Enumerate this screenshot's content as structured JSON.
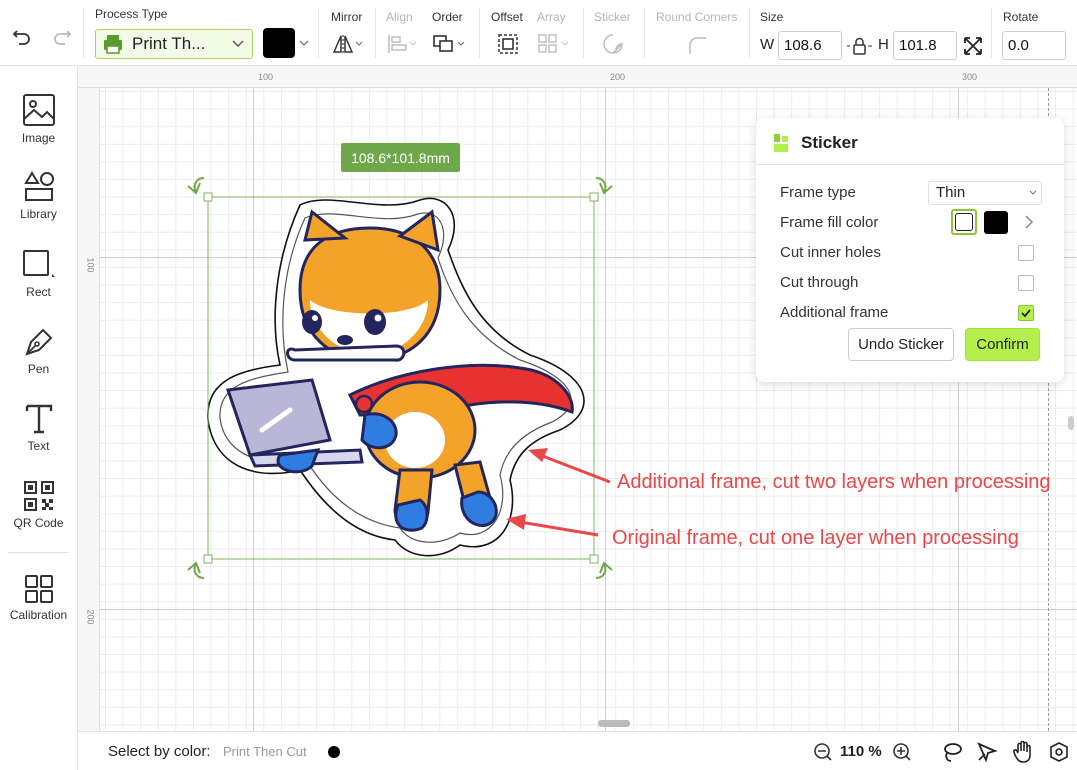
{
  "toolbar": {
    "process_type_label": "Process Type",
    "process_type_value": "Print Th...",
    "mirror_label": "Mirror",
    "align_label": "Align",
    "order_label": "Order",
    "offset_label": "Offset",
    "array_label": "Array",
    "sticker_label": "Sticker",
    "round_corners_label": "Round Corners",
    "size_label": "Size",
    "width_prefix": "W",
    "width_value": "108.6",
    "height_prefix": "H",
    "height_value": "101.8",
    "rotate_label": "Rotate",
    "rotate_value": "0.0",
    "fill_color": "#000000"
  },
  "sidebar": {
    "items": [
      {
        "label": "Image",
        "icon": "image-icon"
      },
      {
        "label": "Library",
        "icon": "library-icon"
      },
      {
        "label": "Rect",
        "icon": "rect-icon"
      },
      {
        "label": "Pen",
        "icon": "pen-icon"
      },
      {
        "label": "Text",
        "icon": "text-icon"
      },
      {
        "label": "QR Code",
        "icon": "qr-code-icon"
      },
      {
        "label": "Calibration",
        "icon": "calibration-icon"
      }
    ]
  },
  "canvas": {
    "ruler_h": [
      "100",
      "200",
      "300"
    ],
    "ruler_v": [
      "100",
      "200"
    ],
    "size_tag": "108.6*101.8mm"
  },
  "sticker_panel": {
    "title": "Sticker",
    "frame_type_label": "Frame type",
    "frame_type_value": "Thin",
    "frame_fill_label": "Frame fill color",
    "cut_inner_holes_label": "Cut inner holes",
    "cut_inner_holes": false,
    "cut_through_label": "Cut through",
    "cut_through": false,
    "additional_frame_label": "Additional frame",
    "additional_frame": true,
    "undo_label": "Undo Sticker",
    "confirm_label": "Confirm",
    "fill_swatches": [
      "#ffffff",
      "#000000"
    ]
  },
  "annotations": {
    "additional": "Additional frame, cut two layers when processing",
    "original": "Original frame, cut one layer when processing"
  },
  "bottombar": {
    "select_by_color_label": "Select by color:",
    "color_mode": "Print Then Cut",
    "zoom": "110 %"
  },
  "colors": {
    "accent_green": "#b4f04b",
    "selection_green": "#6fa84b",
    "annotation_red": "#e8484a"
  }
}
